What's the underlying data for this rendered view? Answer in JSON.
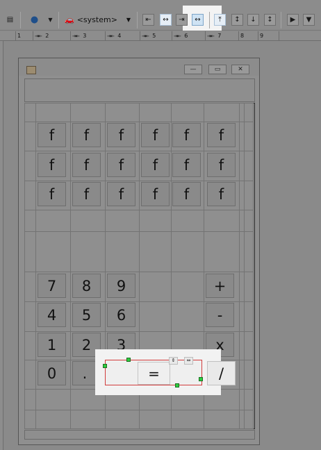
{
  "toolbar": {
    "laf_label": "<system>",
    "buttons": [
      {
        "name": "preview",
        "glyph": "▤"
      },
      {
        "name": "globe",
        "glyph": "●"
      },
      {
        "name": "align-left",
        "glyph": "⇤"
      },
      {
        "name": "center-horizontal",
        "glyph": "↔"
      },
      {
        "name": "align-right",
        "glyph": "⇥"
      },
      {
        "name": "fill-horizontal",
        "glyph": "↔"
      },
      {
        "name": "align-top",
        "glyph": "⤒"
      },
      {
        "name": "center-vertical",
        "glyph": "↕"
      },
      {
        "name": "align-bottom",
        "glyph": "↓"
      },
      {
        "name": "fill-vertical",
        "glyph": "↕"
      },
      {
        "name": "run",
        "glyph": "▶"
      },
      {
        "name": "menu",
        "glyph": "▼"
      }
    ]
  },
  "ruler": {
    "columns": [
      "1",
      "2",
      "3",
      "4",
      "5",
      "6",
      "7",
      "8",
      "9"
    ]
  },
  "frame": {
    "window_buttons": [
      {
        "name": "minimize",
        "glyph": "—"
      },
      {
        "name": "maximize",
        "glyph": "▭"
      },
      {
        "name": "close",
        "glyph": "✕"
      }
    ]
  },
  "calculator": {
    "function_rows": [
      [
        "f",
        "f",
        "f",
        "f",
        "f",
        "f"
      ],
      [
        "f",
        "f",
        "f",
        "f",
        "f",
        "f"
      ],
      [
        "f",
        "f",
        "f",
        "f",
        "f",
        "f"
      ]
    ],
    "digit_rows": [
      [
        "7",
        "8",
        "9"
      ],
      [
        "4",
        "5",
        "6"
      ],
      [
        "1",
        "2",
        "3"
      ],
      [
        "0",
        "."
      ]
    ],
    "operators": [
      "+",
      "-",
      "x",
      "/"
    ],
    "equals": "="
  }
}
